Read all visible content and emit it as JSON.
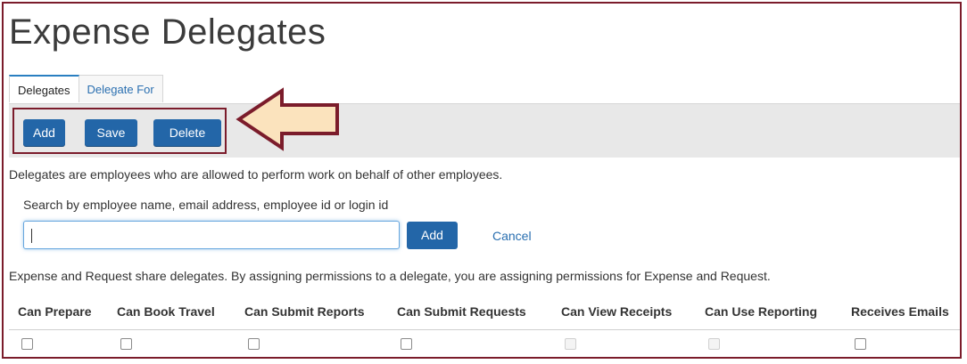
{
  "page_title": "Expense Delegates",
  "tabs": [
    {
      "label": "Delegates",
      "active": true
    },
    {
      "label": "Delegate For",
      "active": false
    }
  ],
  "toolbar": {
    "add_label": "Add",
    "save_label": "Save",
    "delete_label": "Delete"
  },
  "description": "Delegates are employees who are allowed to perform work on behalf of other employees.",
  "search": {
    "label": "Search by employee name, email address, employee id or login id",
    "value": "",
    "add_label": "Add",
    "cancel_label": "Cancel"
  },
  "note": "Expense and Request share delegates. By assigning permissions to a delegate, you are assigning permissions for Expense and Request.",
  "permissions": [
    {
      "label": "Can Prepare",
      "enabled": true,
      "checked": false
    },
    {
      "label": "Can Book Travel",
      "enabled": true,
      "checked": false
    },
    {
      "label": "Can Submit Reports",
      "enabled": true,
      "checked": false
    },
    {
      "label": "Can Submit Requests",
      "enabled": true,
      "checked": false
    },
    {
      "label": "Can View Receipts",
      "enabled": false,
      "checked": false
    },
    {
      "label": "Can Use Reporting",
      "enabled": false,
      "checked": false
    },
    {
      "label": "Receives Emails",
      "enabled": true,
      "checked": false
    }
  ],
  "colors": {
    "primary_button": "#2366a8",
    "highlight_border": "#7b1c2b",
    "callout_arrow_fill": "#fbe3bd",
    "link": "#2a6fb0"
  },
  "icons": {
    "callout": "left-arrow-icon"
  }
}
